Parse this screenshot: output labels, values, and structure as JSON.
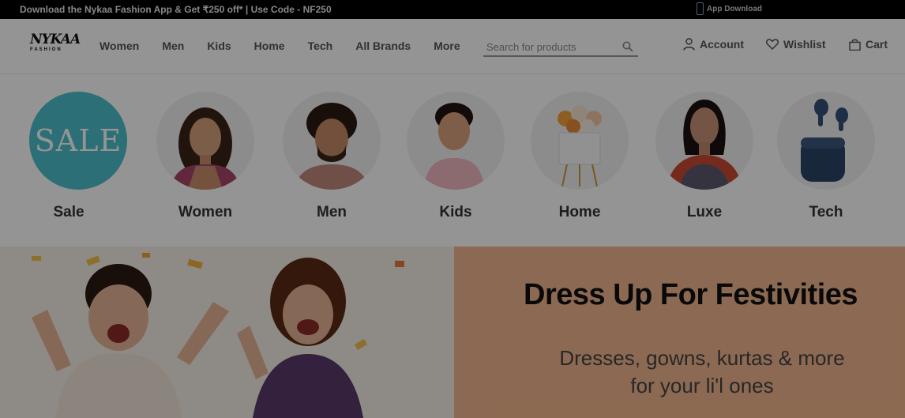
{
  "topbar": {
    "promo_text": "Download the Nykaa Fashion App & Get ₹250 off* | Use Code - NF250",
    "app_download_label": "App Download"
  },
  "header": {
    "logo_line1": "NYKAA",
    "logo_line2": "FASHION",
    "nav": [
      "Women",
      "Men",
      "Kids",
      "Home",
      "Tech",
      "All Brands",
      "More"
    ],
    "search_placeholder": "Search for products",
    "account_label": "Account",
    "wishlist_label": "Wishlist",
    "cart_label": "Cart"
  },
  "categories": [
    {
      "label": "Sale",
      "circle_text": "SALE"
    },
    {
      "label": "Women"
    },
    {
      "label": "Men"
    },
    {
      "label": "Kids"
    },
    {
      "label": "Home"
    },
    {
      "label": "Luxe"
    },
    {
      "label": "Tech"
    }
  ],
  "banner": {
    "title": "Dress Up For Festivities",
    "subtitle_line1": "Dresses, gowns, kurtas & more",
    "subtitle_line2": "for your li'l ones"
  },
  "colors": {
    "sale_circle": "#4dbfcc",
    "banner_right_bg": "#f1b68d",
    "overlay": "rgba(0,0,0,0.42)"
  }
}
